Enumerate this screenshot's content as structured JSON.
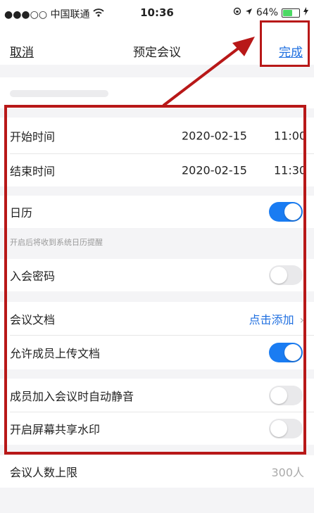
{
  "status": {
    "carrier": "●●●○○ 中国联通",
    "wifi_icon": "wifi-icon",
    "time": "10:36",
    "battery_pct": "64%",
    "battery_level": 0.64
  },
  "nav": {
    "cancel": "取消",
    "title": "预定会议",
    "done": "完成"
  },
  "start": {
    "label": "开始时间",
    "date": "2020-02-15",
    "time": "11:00"
  },
  "end": {
    "label": "结束时间",
    "date": "2020-02-15",
    "time": "11:30"
  },
  "calendar": {
    "label": "日历",
    "on": true,
    "hint": "开启后将收到系统日历提醒"
  },
  "password": {
    "label": "入会密码",
    "on": false
  },
  "docs": {
    "label": "会议文档",
    "action": "点击添加",
    "chevron": "›"
  },
  "upload": {
    "label": "允许成员上传文档",
    "on": true
  },
  "mute": {
    "label": "成员加入会议时自动静音",
    "on": false
  },
  "watermark": {
    "label": "开启屏幕共享水印",
    "on": false
  },
  "limit": {
    "label": "会议人数上限",
    "value": "300人"
  },
  "colors": {
    "accent": "#1f6fe0",
    "toggle_on": "#1a7cf2",
    "annotation": "#b81818"
  }
}
